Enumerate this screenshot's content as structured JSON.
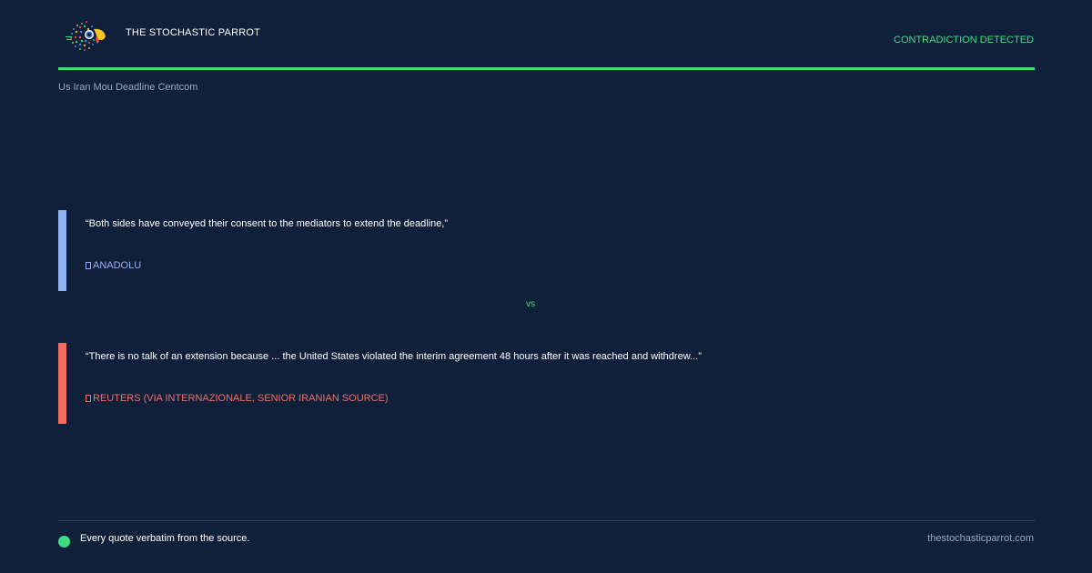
{
  "header": {
    "brand": "THE STOCHASTIC PARROT",
    "status": "CONTRADICTION DETECTED",
    "logo_icon": "parrot-logo-icon"
  },
  "slug": "Us Iran Mou Deadline Centcom",
  "quotes": [
    {
      "text": "“Both sides have conveyed their consent to the mediators to extend the deadline,”",
      "source": "ANADOLU",
      "icon": "source-icon",
      "color": "#8fb2f0"
    },
    {
      "text": "“There is no talk of an extension because ... the United States violated the interim agreement 48 hours after it was reached and withdrew...”",
      "source": "REUTERS (VIA INTERNAZIONALE, SENIOR IRANIAN SOURCE)",
      "icon": "source-icon",
      "color": "#ef6f63"
    }
  ],
  "vs_label": "vs",
  "footer": {
    "note": "Every quote verbatim from the source.",
    "site": "thestochasticparrot.com"
  },
  "colors": {
    "background": "#11203a",
    "accent": "#3ddc84",
    "muted": "#9aa8bd"
  }
}
